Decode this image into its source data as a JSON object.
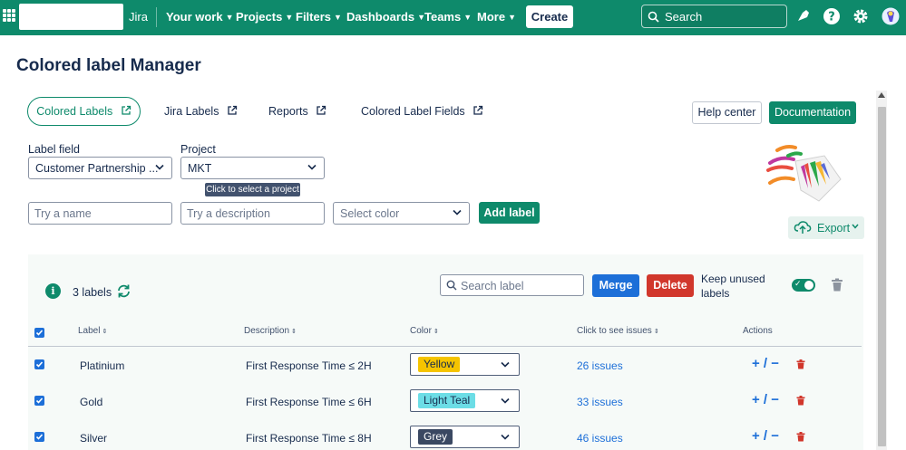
{
  "topbar": {
    "product": "Jira",
    "nav": [
      {
        "label": "Your work"
      },
      {
        "label": "Projects"
      },
      {
        "label": "Filters"
      },
      {
        "label": "Dashboards"
      },
      {
        "label": "Teams"
      },
      {
        "label": "More"
      }
    ],
    "create_label": "Create",
    "search_placeholder": "Search",
    "icons": [
      "notifications-icon",
      "help-icon",
      "settings-icon",
      "profile-avatar"
    ],
    "accent_color": "#0e8a6b"
  },
  "page": {
    "title": "Colored label Manager"
  },
  "tabs": [
    {
      "label": "Colored Labels",
      "active": true
    },
    {
      "label": "Jira Labels"
    },
    {
      "label": "Reports"
    },
    {
      "label": "Colored Label Fields"
    }
  ],
  "actions": {
    "help_center": "Help center",
    "documentation": "Documentation",
    "export": "Export"
  },
  "filters": {
    "label_field_label": "Label field",
    "label_field_value": "Customer Partnership ...",
    "project_label": "Project",
    "project_value": "MKT",
    "project_tooltip": "Click to select a project"
  },
  "new_label": {
    "name_placeholder": "Try a name",
    "description_placeholder": "Try a description",
    "color_placeholder": "Select color",
    "add_label": "Add label"
  },
  "labels_panel": {
    "count_text": "3 labels",
    "search_placeholder": "Search label",
    "merge": "Merge",
    "delete": "Delete",
    "keep_unused": "Keep unused labels",
    "keep_unused_enabled": true,
    "columns": {
      "label": "Label",
      "description": "Description",
      "color": "Color",
      "issues": "Click to see issues",
      "actions": "Actions"
    },
    "rows": [
      {
        "label": "Platinium",
        "description": "First Response Time ≤ 2H",
        "color": "Yellow",
        "color_hex": "#f5c400",
        "text_color": "#172b4d",
        "issues": "26 issues",
        "checked": true
      },
      {
        "label": "Gold",
        "description": "First Response Time ≤ 6H",
        "color": "Light Teal",
        "color_hex": "#6cdde6",
        "text_color": "#172b4d",
        "issues": "33 issues",
        "checked": true
      },
      {
        "label": "Silver",
        "description": "First Response Time ≤ 8H",
        "color": "Grey",
        "color_hex": "#3a4862",
        "text_color": "#ffffff",
        "issues": "46 issues",
        "checked": true
      }
    ],
    "row_actions": "+ / −"
  }
}
